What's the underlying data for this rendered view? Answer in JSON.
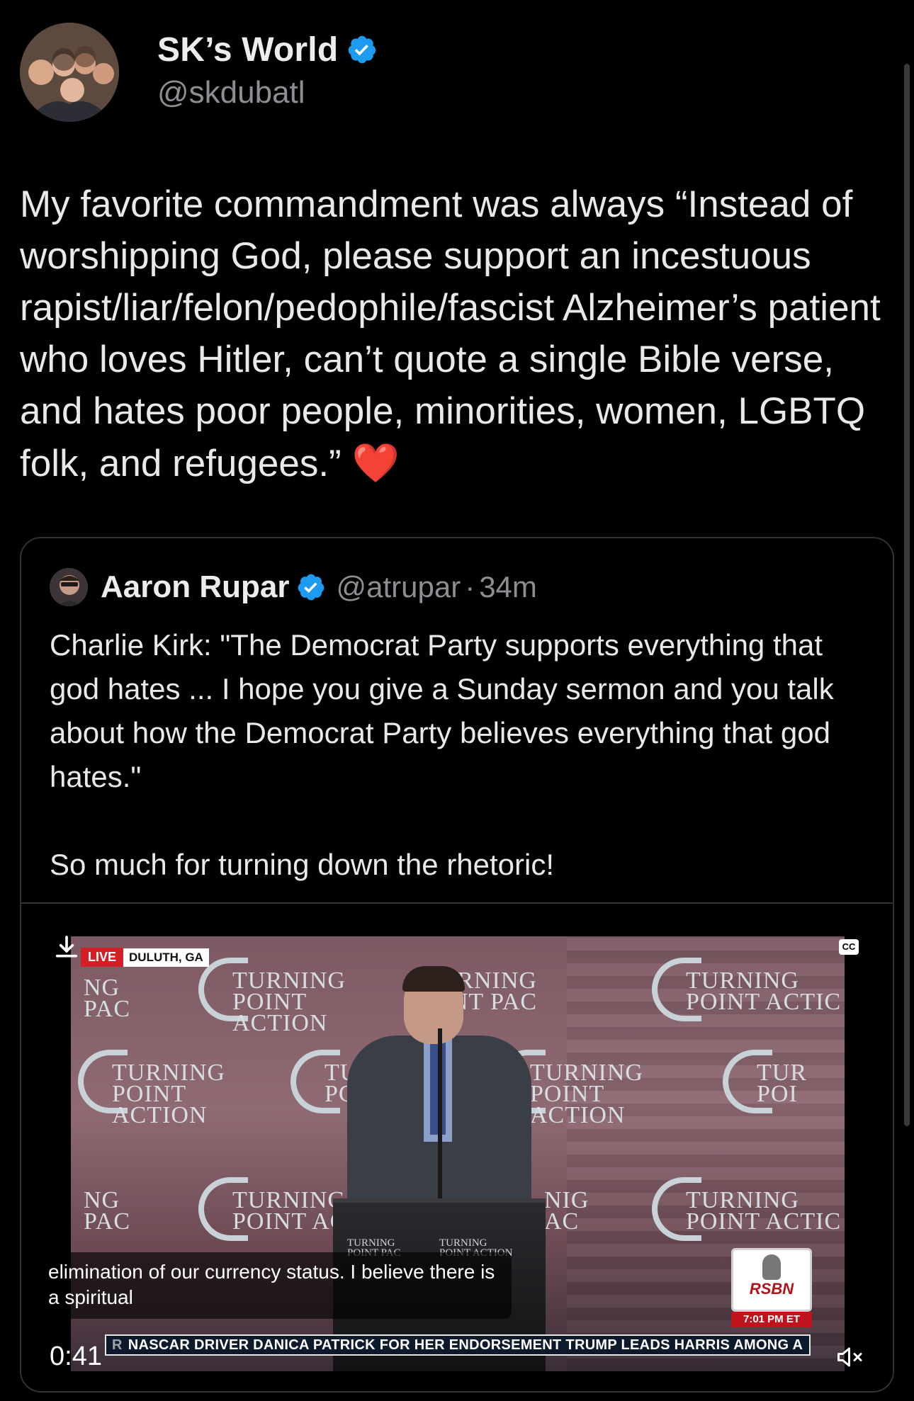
{
  "author": {
    "display_name": "SK’s World",
    "handle": "@skdubatl",
    "verified": true
  },
  "tweet": {
    "text": "My favorite commandment was always “Instead of worshipping God, please support an incestuous rapist/liar/felon/pedophile/fascist Alzheimer’s patient who loves Hitler, can’t quote a single Bible verse, and hates poor people, minorities, women, LGBTQ folk, and refugees.”",
    "emoji": "❤️"
  },
  "quote": {
    "display_name": "Aaron Rupar",
    "handle": "@atrupar",
    "separator": "·",
    "time": "34m",
    "text": "Charlie Kirk: \"The Democrat Party supports everything that god hates ... I hope you give a Sunday sermon and you talk about how the Democrat Party believes everything that god hates.\"\n\nSo much for turning down the rhetoric!"
  },
  "video": {
    "live_label": "LIVE",
    "location": "DULUTH, GA",
    "cc_label": "CC",
    "captions": "elimination of our currency status. I believe there is a spiritual",
    "network": "RSBN",
    "network_time": "7:01 PM ET",
    "ticker_left": "R",
    "ticker": "NASCAR DRIVER DANICA PATRICK FOR HER ENDORSEMENT    TRUMP LEADS HARRIS AMONG A",
    "timestamp": "0:41",
    "muted": true,
    "backdrop_text": {
      "turning": "TURNING",
      "point_action": "POINT ACTION",
      "point_pac": "POINT PAC",
      "ng": "NG",
      "pac": "PAC",
      "tur": "TUR",
      "poi": "POI",
      "tu": "TU",
      "pc": "PC",
      "point_ac": "POINT AC",
      "point_actic": "POINT ACTIC",
      "oint_pac": "OINT PAC",
      "nig": "NIG",
      "ac": "AC"
    },
    "podium_marks": {
      "left_top": "TURNING",
      "left_bottom": "POINT PAC",
      "right_top": "TURNING",
      "right_bottom": "POINT ACTION"
    }
  },
  "colors": {
    "background": "#000000",
    "text": "#e7e9ea",
    "muted_text": "#8b8e92",
    "verified": "#1d9bf0",
    "border": "#2f3336",
    "live_red": "#d31f26"
  }
}
